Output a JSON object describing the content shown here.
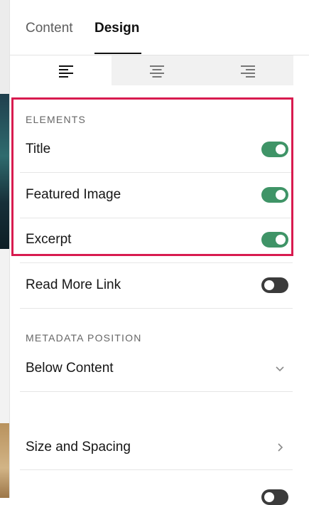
{
  "tabs": {
    "content": "Content",
    "design": "Design",
    "active": "design"
  },
  "alignment": {
    "options": [
      "align-left",
      "align-center",
      "align-right"
    ],
    "selected": "align-left"
  },
  "elements": {
    "section_label": "ELEMENTS",
    "title": {
      "label": "Title",
      "enabled": true
    },
    "featured_image": {
      "label": "Featured Image",
      "enabled": true
    },
    "excerpt": {
      "label": "Excerpt",
      "enabled": true
    },
    "read_more": {
      "label": "Read More Link",
      "enabled": false
    }
  },
  "metadata": {
    "section_label": "METADATA POSITION",
    "value": "Below Content"
  },
  "size_spacing": {
    "label": "Size and Spacing"
  },
  "colors": {
    "toggle_on": "#3f9467",
    "toggle_off": "#3b3b3b",
    "highlight": "#d81b4f"
  }
}
